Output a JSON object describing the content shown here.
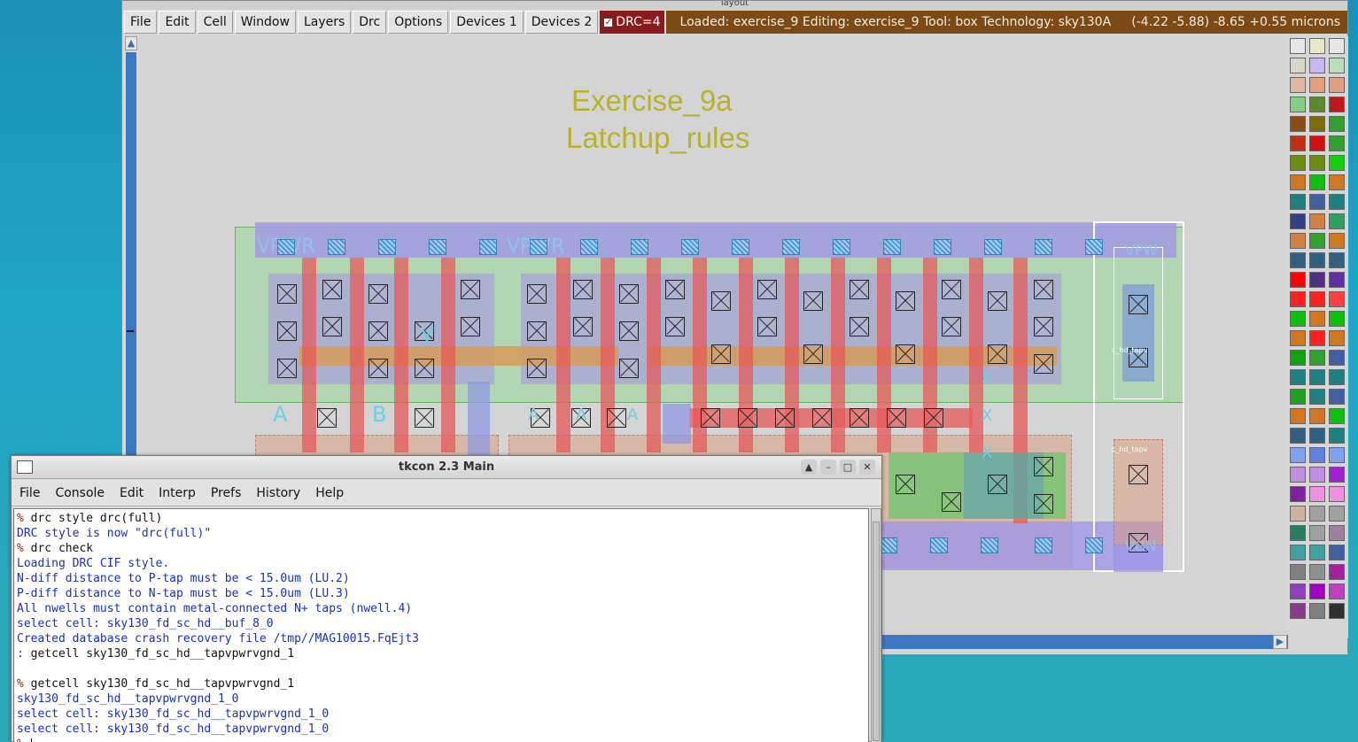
{
  "magic": {
    "window_title": "layout",
    "menus": [
      "File",
      "Edit",
      "Cell",
      "Window",
      "Layers",
      "Drc",
      "Options",
      "Devices 1",
      "Devices 2"
    ],
    "drc_indicator": "DRC=4",
    "status": "Loaded: exercise_9 Editing: exercise_9 Tool: box  Technology: sky130A",
    "coords": "(-4.22 -5.88) -8.65 +0.55 microns",
    "canvas_title_1": "Exercise_9a",
    "canvas_title_2": "Latchup_rules",
    "labels": {
      "vpwr_1": "VPWR",
      "vpwr_2": "VPWR",
      "a1": "A",
      "b1": "B",
      "y1": "Y",
      "a2": "A",
      "a3": "A",
      "a4": "A",
      "x1": "X",
      "x2": "X",
      "x3": "X",
      "tap_top": "VPW",
      "tap_bot": "VGN",
      "tap_name_1": "c_hd_tapv",
      "tap_name_2": "c_hd_tapv"
    }
  },
  "tkcon": {
    "title": "tkcon 2.3 Main",
    "menus": [
      "File",
      "Console",
      "Edit",
      "Interp",
      "Prefs",
      "History",
      "Help"
    ],
    "lines": [
      {
        "p": "% ",
        "t": "drc style drc(full)",
        "k": "cmd"
      },
      {
        "p": "",
        "t": "DRC style is now \"drc(full)\"",
        "k": "out"
      },
      {
        "p": "% ",
        "t": "drc check",
        "k": "cmd"
      },
      {
        "p": "",
        "t": "Loading DRC CIF style.",
        "k": "out"
      },
      {
        "p": "",
        "t": "N-diff distance to P-tap must be < 15.0um (LU.2)",
        "k": "out"
      },
      {
        "p": "",
        "t": "P-diff distance to N-tap must be < 15.0um (LU.3)",
        "k": "out"
      },
      {
        "p": "",
        "t": "All nwells must contain metal-connected N+ taps (nwell.4)",
        "k": "out"
      },
      {
        "p": "",
        "t": "select cell: sky130_fd_sc_hd__buf_8_0",
        "k": "out"
      },
      {
        "p": "",
        "t": "Created database crash recovery file /tmp//MAG10015.FqEjt3",
        "k": "out"
      },
      {
        "p": ": ",
        "t": "getcell sky130_fd_sc_hd__tapvpwrvgnd_1",
        "k": "cmd"
      },
      {
        "p": "",
        "t": "",
        "k": "out"
      },
      {
        "p": "% ",
        "t": "getcell sky130_fd_sc_hd__tapvpwrvgnd_1",
        "k": "cmd"
      },
      {
        "p": "",
        "t": "sky130_fd_sc_hd__tapvpwrvgnd_1_0",
        "k": "out"
      },
      {
        "p": "",
        "t": "select cell: sky130_fd_sc_hd__tapvpwrvgnd_1_0",
        "k": "out"
      },
      {
        "p": "",
        "t": "select cell: sky130_fd_sc_hd__tapvpwrvgnd_1_0",
        "k": "out"
      },
      {
        "p": "% ",
        "t": "",
        "k": "cmd"
      }
    ]
  },
  "colors": {
    "status_bg": "#7c4a14",
    "drc_bg": "#8b1a1a",
    "title_text": "#b8b22a",
    "metal1": "#a8a2e0",
    "poly": "#e06060",
    "ndiff": "#d89a50",
    "nwell": "#a8d8a0",
    "label": "#6ad0e6"
  },
  "icons": {
    "scroll_up": "arrow-up-icon",
    "scroll_right": "arrow-right-icon",
    "tkcon_app": "window-icon",
    "tk_up": "arrow-up-icon",
    "tk_min": "minimize-icon",
    "tk_max": "maximize-icon",
    "tk_close": "close-icon"
  }
}
